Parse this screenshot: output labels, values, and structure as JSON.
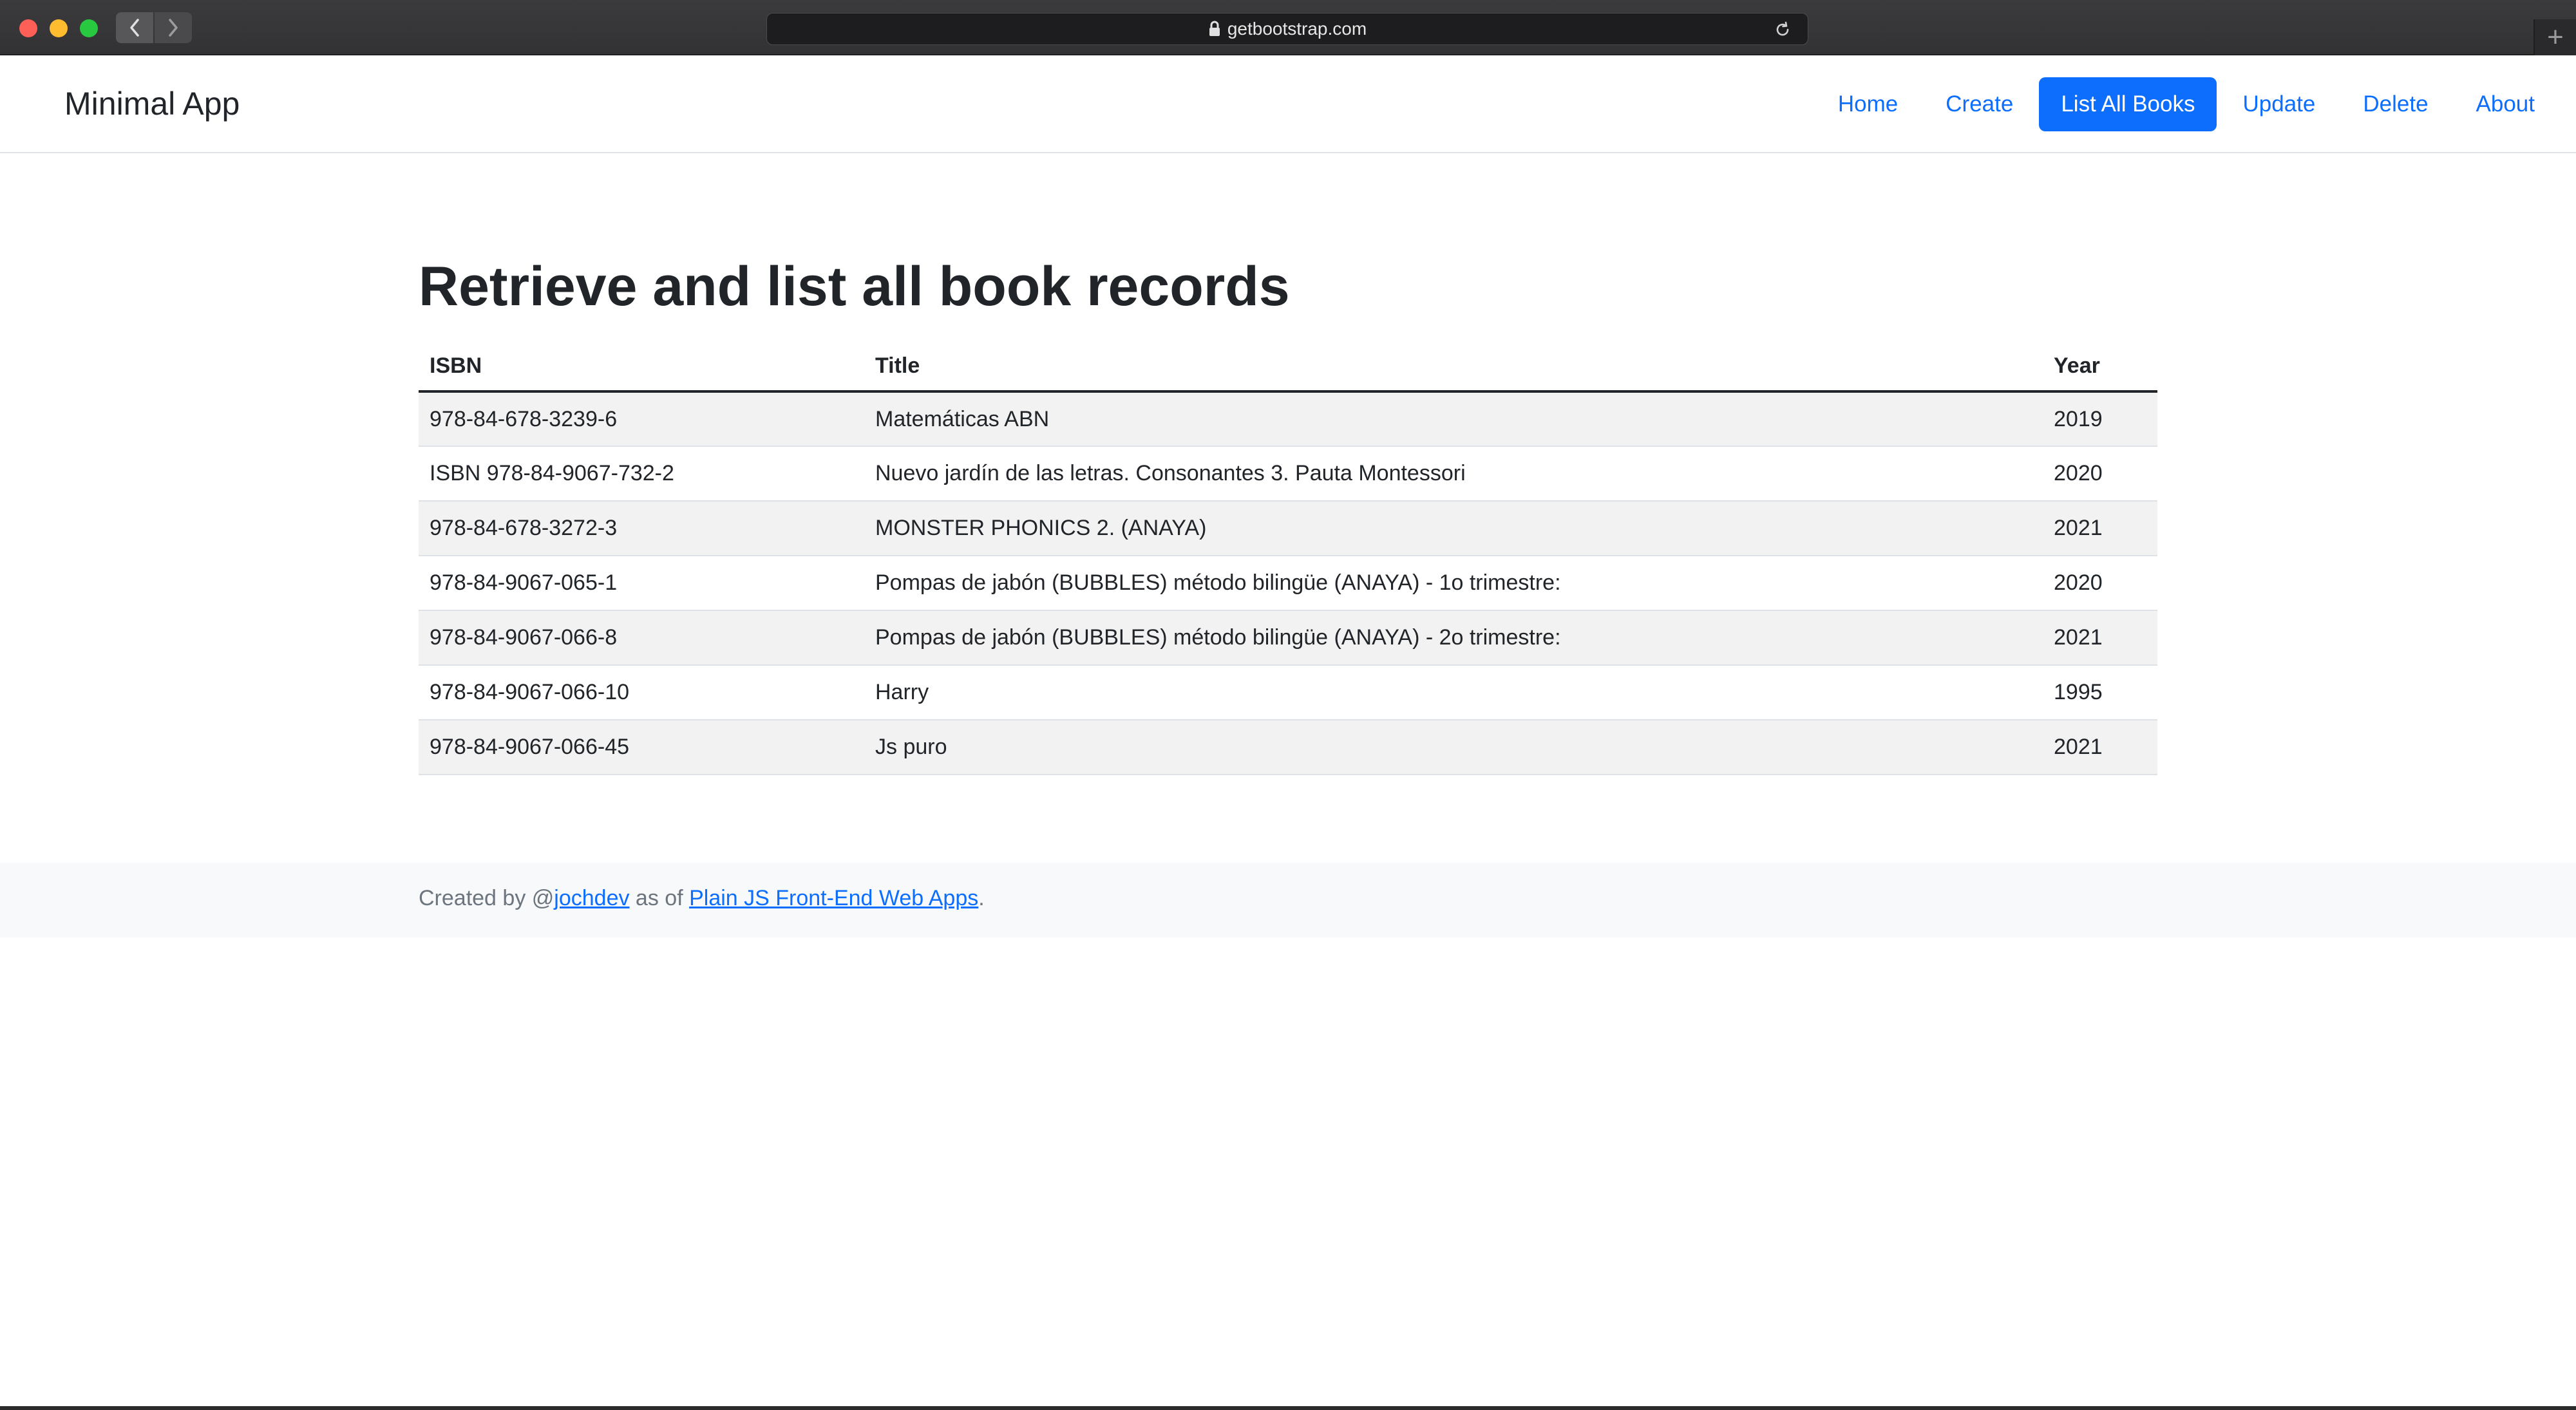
{
  "browser": {
    "url": "getbootstrap.com",
    "new_tab_label": "+"
  },
  "navbar": {
    "brand": "Minimal App",
    "links": [
      {
        "label": "Home",
        "active": false
      },
      {
        "label": "Create",
        "active": false
      },
      {
        "label": "List All Books",
        "active": true
      },
      {
        "label": "Update",
        "active": false
      },
      {
        "label": "Delete",
        "active": false
      },
      {
        "label": "About",
        "active": false
      }
    ]
  },
  "main": {
    "title": "Retrieve and list all book records",
    "table": {
      "headers": {
        "isbn": "ISBN",
        "title": "Title",
        "year": "Year"
      },
      "rows": [
        {
          "isbn": "978-84-678-3239-6",
          "title": "Matemáticas ABN",
          "year": "2019"
        },
        {
          "isbn": "ISBN 978-84-9067-732-2",
          "title": "Nuevo jardín de las letras. Consonantes 3. Pauta Montessori",
          "year": "2020"
        },
        {
          "isbn": "978-84-678-3272-3",
          "title": "MONSTER PHONICS 2. (ANAYA)",
          "year": "2021"
        },
        {
          "isbn": "978-84-9067-065-1",
          "title": "Pompas de jabón (BUBBLES) método bilingüe (ANAYA) - 1o trimestre:",
          "year": "2020"
        },
        {
          "isbn": "978-84-9067-066-8",
          "title": "Pompas de jabón (BUBBLES) método bilingüe (ANAYA) - 2o trimestre:",
          "year": "2021"
        },
        {
          "isbn": "978-84-9067-066-10",
          "title": "Harry",
          "year": "1995"
        },
        {
          "isbn": "978-84-9067-066-45",
          "title": "Js puro",
          "year": "2021"
        }
      ]
    }
  },
  "footer": {
    "prefix": "Created by @",
    "author_link": "jochdev",
    "middle": " as of ",
    "book_link": "Plain JS Front-End Web Apps",
    "suffix": "."
  },
  "colors": {
    "accent": "#0d6efd",
    "striped_row": "#f2f2f2",
    "footer_bg": "#f8f9fa"
  }
}
